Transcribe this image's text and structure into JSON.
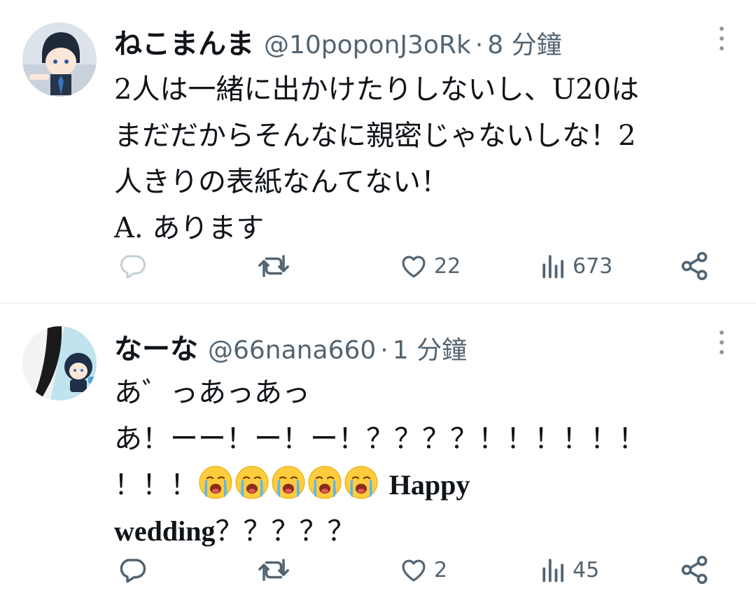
{
  "tweets": [
    {
      "display_name": "ねこまんま",
      "handle": "@10poponJ3oRk",
      "separator": "·",
      "time": "8 分鐘",
      "text_lines": [
        "2人は一緒に出かけたりしないし、U20は",
        "まだだからそんなに親密じゃないしな！2",
        "人きりの表紙なんてない！",
        "A. あります"
      ],
      "replies": "",
      "retweets": "",
      "likes": "22",
      "views": "673"
    },
    {
      "display_name": "なーな",
      "handle": "@66nana660",
      "separator": "·",
      "time": "1 分鐘",
      "text_lines": [
        "あ゛っあっあっ",
        "あ！ーー！ー！ー！？？？？！！！！！！",
        "！！！",
        "Happy",
        "wedding",
        "？？？？？"
      ],
      "replies": "",
      "retweets": "",
      "likes": "2",
      "views": "45"
    }
  ],
  "icons": {
    "reply": "reply-icon",
    "retweet": "retweet-icon",
    "like": "heart-icon",
    "views": "views-icon",
    "share": "share-icon",
    "more": "more-icon",
    "emoji": "loudly-crying-face-emoji"
  },
  "colors": {
    "text": "#0f1419",
    "secondary": "#536471",
    "divider": "#eff3f4"
  }
}
